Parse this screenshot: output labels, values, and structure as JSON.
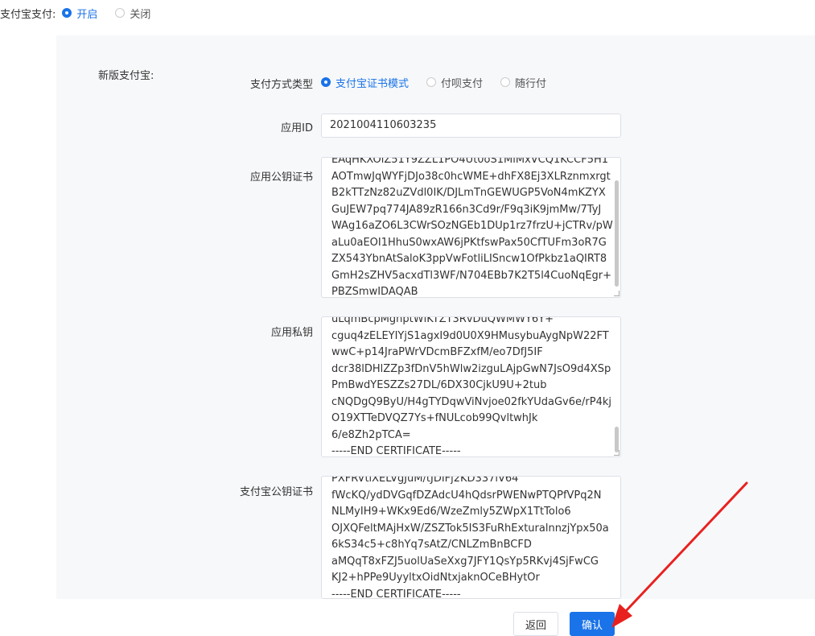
{
  "top_toggle": {
    "label": "支付宝支付:",
    "options": [
      {
        "label": "开启",
        "checked": true
      },
      {
        "label": "关闭",
        "checked": false
      }
    ]
  },
  "section": {
    "title": "新版支付宝:"
  },
  "pay_type": {
    "label": "支付方式类型",
    "options": [
      {
        "label": "支付宝证书模式",
        "checked": true
      },
      {
        "label": "付呗支付",
        "checked": false
      },
      {
        "label": "随行付",
        "checked": false
      }
    ]
  },
  "app_id": {
    "label": "应用ID",
    "value": "2021004110603235"
  },
  "app_public_cert": {
    "label": "应用公钥证书",
    "value": "EAqHKXOlZ51Y9ZZL1PO4Ut0oS1MlMxVCQ1KCCF5H1\nAOTmwJqWYFjDJo38c0hcWME+dhFX8Ej3XLRznmxrgt\nB2kTTzNz82uZVdl0IK/DJLmTnGEWUGP5VoN4mKZYX\nGuJEW7pq774JA89zR166n3Cd9r/F9q3iK9jmMw/7TyJ\nWAg16aZO6L3CWrSOzNGEb1DUp1rz7frzU+jCTRv/pW\naLu0aEOI1HhuS0wxAW6jPKtfswPax50CfTUFm3oR7G\nZX543YbnAtSaloK3ppVwFotliLISncw1OfPkbz1aQIRT8\nGmH2sZHV5acxdTl3WF/N704EBb7K2T5l4CuoNqEgr+\nPBZSmwIDAQAB"
  },
  "app_private_key": {
    "label": "应用私钥",
    "value": "uLqmBcpMghptWlKTZT3RvDuQWMWY6Y+\ncguq4zELEYIYjS1agxI9d0U0X9HMusybuAygNpW22FT\nwwC+p14JraPWrVDcmBFZxfM/eo7DfJ5IF\ndcr38lDHlZZp3fDnV5hWlw2izguLAjpGwN7JsO9d4XSp\nPmBwdYESZZs27DL/6DX30CjkU9U+2tub\ncNQDgQ9ByU/H4gTYDqwViNvjoe02fkYUdaGv6e/rP4kj\nO19XTTeDVQZ7Ys+fNULcob99QvltwhJk\n6/e8Zh2pTCA=\n-----END CERTIFICATE-----"
  },
  "alipay_public_cert": {
    "label": "支付宝公钥证书",
    "value": "PXFRVtlXELVgJuM/tJDIFj2KD337lV64\nfWcKQ/ydDVGqfDZAdcU4hQdsrPWENwPTQPfVPq2N\nNLMyIH9+WKx9Ed6/WzeZmly5ZWpX1TtTolo6\nOJXQFeltMAjHxW/ZSZTok5IS3FuRhExturalnnzjYpx50a\n6kS34c5+c8hYq7sAtZ/CNLZmBnBCFD\naMQqT8xFZJ5uolUaSeXxg7JFY1QsYp5RKvj4SjFwCG\nKJ2+hPPe9UyyltxOidNtxjaknOCeBHytOr\n-----END CERTIFICATE-----"
  },
  "buttons": {
    "back": "返回",
    "confirm": "确认"
  },
  "colors": {
    "primary": "#1a73e8",
    "arrow": "#e8211f"
  }
}
